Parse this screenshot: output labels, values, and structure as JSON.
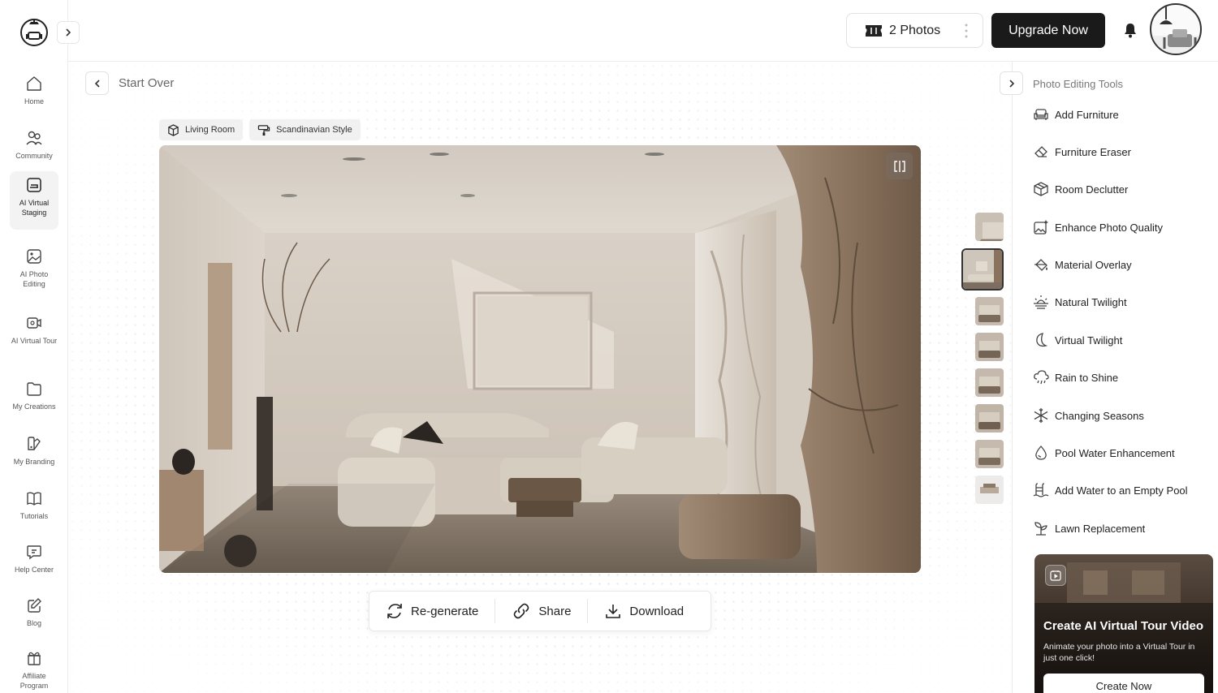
{
  "sidebar": {
    "items": [
      {
        "label": "Home",
        "icon": "home-icon"
      },
      {
        "label": "Community",
        "icon": "community-icon"
      },
      {
        "label": "AI Virtual Staging",
        "icon": "virtual-staging-icon",
        "active": true
      },
      {
        "label": "AI Photo Editing",
        "icon": "photo-editing-icon"
      },
      {
        "label": "AI Virtual Tour",
        "icon": "virtual-tour-icon"
      },
      {
        "label": "My Creations",
        "icon": "folder-icon"
      },
      {
        "label": "My Branding",
        "icon": "branding-icon"
      },
      {
        "label": "Tutorials",
        "icon": "book-icon"
      },
      {
        "label": "Help Center",
        "icon": "help-icon"
      },
      {
        "label": "Blog",
        "icon": "edit-icon"
      },
      {
        "label": "Affiliate Program",
        "icon": "gift-icon"
      }
    ]
  },
  "header": {
    "photos_label": "2 Photos",
    "upgrade_label": "Upgrade Now"
  },
  "main": {
    "start_over_label": "Start Over",
    "tags": [
      {
        "label": "Living Room",
        "icon": "cube-icon"
      },
      {
        "label": "Scandinavian Style",
        "icon": "paint-roller-icon"
      }
    ],
    "actions": [
      {
        "label": "Re-generate",
        "icon": "refresh-icon"
      },
      {
        "label": "Share",
        "icon": "link-icon"
      },
      {
        "label": "Download",
        "icon": "download-icon"
      }
    ],
    "thumbnail_count": 8,
    "selected_thumbnail": 1
  },
  "right_panel": {
    "title": "Photo Editing Tools",
    "tools": [
      {
        "label": "Add Furniture",
        "icon": "sofa-icon"
      },
      {
        "label": "Furniture Eraser",
        "icon": "eraser-icon"
      },
      {
        "label": "Room Declutter",
        "icon": "box-icon"
      },
      {
        "label": "Enhance Photo Quality",
        "icon": "sparkle-image-icon"
      },
      {
        "label": "Material Overlay",
        "icon": "paint-bucket-icon"
      },
      {
        "label": "Natural Twilight",
        "icon": "sunset-icon"
      },
      {
        "label": "Virtual Twilight",
        "icon": "moon-icon"
      },
      {
        "label": "Rain to Shine",
        "icon": "rain-cloud-icon"
      },
      {
        "label": "Changing Seasons",
        "icon": "snowflake-icon"
      },
      {
        "label": "Pool Water Enhancement",
        "icon": "water-drop-icon"
      },
      {
        "label": "Add Water to an Empty Pool",
        "icon": "pool-ladder-icon"
      },
      {
        "label": "Lawn Replacement",
        "icon": "sprout-icon"
      }
    ],
    "promo": {
      "title": "Create AI Virtual Tour Video",
      "subtitle": "Animate your photo into a Virtual Tour in just one click!",
      "button_label": "Create Now"
    }
  },
  "colors": {
    "primary_button": "#1a1a1a",
    "border": "#ececec",
    "active_nav_bg": "#f3f3f3"
  }
}
